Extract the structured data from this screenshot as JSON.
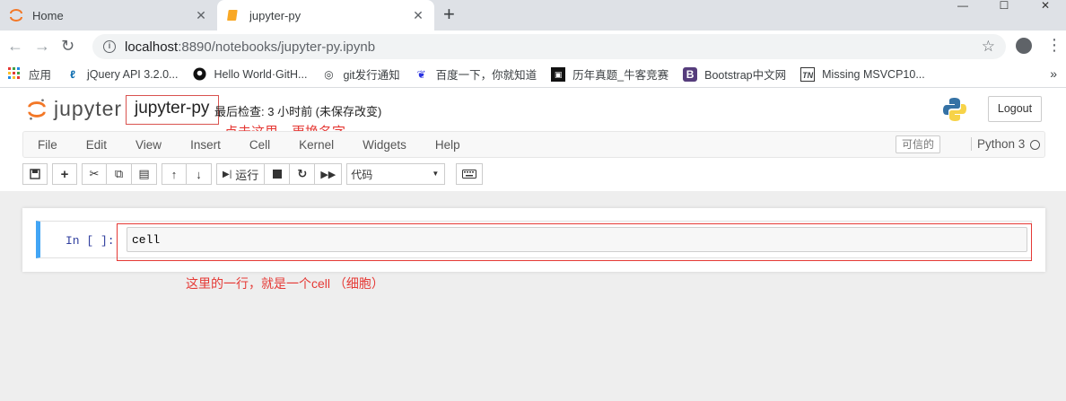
{
  "browser": {
    "tabs": [
      {
        "label": "Home",
        "active": false
      },
      {
        "label": "jupyter-py",
        "active": true
      }
    ],
    "url_host": "localhost",
    "url_rest": ":8890/notebooks/jupyter-py.ipynb",
    "window_controls": [
      "—",
      "☐",
      "✕"
    ]
  },
  "bookmarks": [
    {
      "label": "应用",
      "icon": "apps-grid-icon"
    },
    {
      "label": "jQuery API 3.2.0...",
      "icon": "jquery-icon"
    },
    {
      "label": "Hello World·GitH...",
      "icon": "github-icon"
    },
    {
      "label": "git发行通知",
      "icon": "git-icon"
    },
    {
      "label": "百度一下，你就知道",
      "icon": "baidu-paw-icon"
    },
    {
      "label": "历年真题_牛客竞赛",
      "icon": "nowcoder-icon"
    },
    {
      "label": "Bootstrap中文网",
      "icon": "bootstrap-icon"
    },
    {
      "label": "Missing MSVCP10...",
      "icon": "tn-icon"
    }
  ],
  "jupyter": {
    "logo_text": "jupyter",
    "notebook_name": "jupyter-py",
    "checkpoint": "最后检查: 3 小时前  (未保存改变)",
    "logout_label": "Logout",
    "menu": [
      "File",
      "Edit",
      "View",
      "Insert",
      "Cell",
      "Kernel",
      "Widgets",
      "Help"
    ],
    "trusted_label": "可信的",
    "kernel_name": "Python 3",
    "run_label": "运行",
    "cell_type": "代码"
  },
  "cell": {
    "prompt": "In  [  ]:",
    "source": "cell"
  },
  "annotations": {
    "rename_hint": "点击这里，更换名字",
    "cell_hint": "这里的一行，就是一个cell （细胞）"
  },
  "colors": {
    "annotation_red": "#e53935",
    "cell_selected_blue": "#42a5f5",
    "jupyter_orange": "#f37726"
  }
}
